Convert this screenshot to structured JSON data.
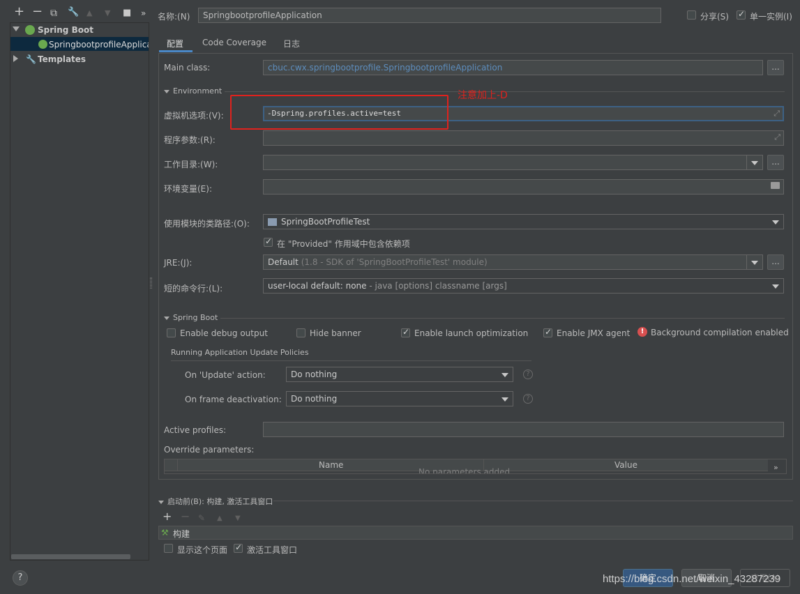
{
  "toolbar": {
    "add": "+",
    "remove": "−",
    "copy": "⧉",
    "edit": "🔧",
    "up": "▲",
    "down": "▼",
    "folder": "▰",
    "more": "»"
  },
  "tree": {
    "root_label": "Spring Boot",
    "child_label": "SpringbootprofileApplica",
    "templates_label": "Templates"
  },
  "header": {
    "name_label": "名称:(N)",
    "name_value": "SpringbootprofileApplication",
    "share_label": "分享(S)",
    "share_checked": false,
    "single_instance_label": "单一实例(I)",
    "single_instance_checked": true
  },
  "tabs": [
    "配置",
    "Code Coverage",
    "日志"
  ],
  "config": {
    "main_class_label": "Main class:",
    "main_class_value": "cbuc.cwx.springbootprofile.SpringbootprofileApplication",
    "dots": "...",
    "environment_label": "Environment",
    "vm_options_label": "虚拟机选项:(V):",
    "vm_options_value": "-Dspring.profiles.active=test",
    "annotation_text": "注意加上-D",
    "program_args_label": "程序参数:(R):",
    "working_dir_label": "工作目录:(W):",
    "env_vars_label": "环境变量(E):",
    "module_classpath_label": "使用模块的类路径:(O):",
    "module_classpath_value": "SpringBootProfileTest",
    "provided_label": "在 \"Provided\" 作用域中包含依赖项",
    "provided_checked": true,
    "jre_label": "JRE:(J):",
    "jre_value": "Default",
    "jre_hint": "(1.8 - SDK of 'SpringBootProfileTest' module)",
    "short_cmd_label": "短的命令行:(L):",
    "short_cmd_value": "user-local default: none",
    "short_cmd_hint": "- java [options] classname [args]"
  },
  "spring_boot": {
    "section_label": "Spring Boot",
    "enable_debug_label": "Enable debug output",
    "enable_debug_checked": false,
    "hide_banner_label": "Hide banner",
    "hide_banner_checked": false,
    "launch_opt_label": "Enable launch optimization",
    "launch_opt_checked": true,
    "jmx_label": "Enable JMX agent",
    "jmx_checked": true,
    "bg_compile_label": "Background compilation enabled",
    "policies_label": "Running Application Update Policies",
    "on_update_label": "On 'Update' action:",
    "on_update_value": "Do nothing",
    "on_frame_label": "On frame deactivation:",
    "on_frame_value": "Do nothing",
    "active_profiles_label": "Active profiles:",
    "override_label": "Override parameters:",
    "table_headers": [
      "Name",
      "Value"
    ],
    "table_empty": "No parameters added.",
    "table_more": "»"
  },
  "before_launch": {
    "label": "启动前(B): 构建, 激活工具窗口",
    "add": "+",
    "remove": "−",
    "item_label": "构建",
    "show_page_label": "显示这个页面",
    "show_page_checked": false,
    "activate_window_label": "激活工具窗口",
    "activate_window_checked": true
  },
  "footer": {
    "help": "?",
    "ok": "确定",
    "cancel": "取消",
    "apply": "应用(A)",
    "watermark": "https://blog.csdn.net/weixin_43287239"
  },
  "colors": {
    "accent": "#4a88c7",
    "annotation_red": "#e0221d",
    "selected_tree": "#0d293e"
  }
}
